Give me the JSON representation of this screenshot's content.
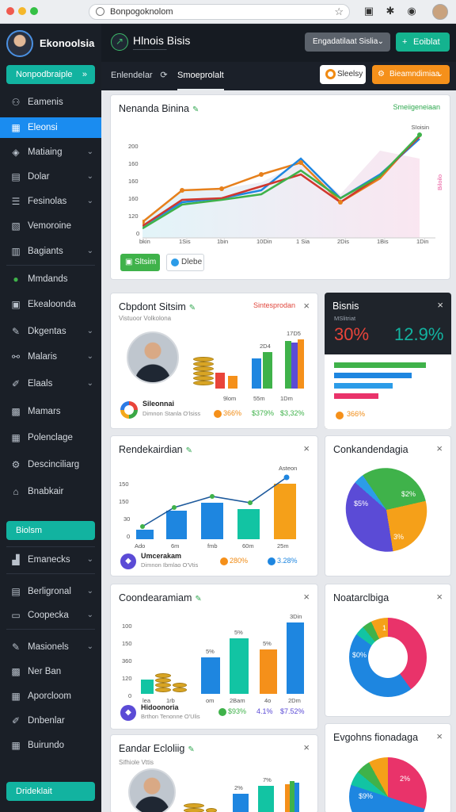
{
  "browser": {
    "url": "Bonpogoknolom",
    "colors": {
      "red": "#f05a4f",
      "yellow": "#f5b72b",
      "green": "#35c045"
    }
  },
  "sidebar": {
    "profile_name": "Ekonoolsia",
    "primary_button": "Nonpodbraiple",
    "primary_button_arrow": "»",
    "items": [
      {
        "label": "Eamenis",
        "icon": "users-icon"
      },
      {
        "label": "Eleonsi",
        "icon": "dashboard-icon"
      },
      {
        "label": "Matiaing",
        "icon": "layers-icon"
      },
      {
        "label": "Dolar",
        "icon": "grid-icon"
      },
      {
        "label": "Fesinolas",
        "icon": "list-icon"
      },
      {
        "label": "Vemoroine",
        "icon": "document-icon"
      },
      {
        "label": "Bagiants",
        "icon": "folder-icon"
      },
      {
        "label": "Mmdands",
        "icon": "chat-icon"
      },
      {
        "label": "Ekealoonda",
        "icon": "briefcase-icon"
      },
      {
        "label": "Dkgentas",
        "icon": "pin-icon"
      },
      {
        "label": "Malaris",
        "icon": "share-icon"
      },
      {
        "label": "Elaals",
        "icon": "edit-icon"
      },
      {
        "label": "Mamars",
        "icon": "building-icon"
      },
      {
        "label": "Polenclage",
        "icon": "calendar-icon"
      },
      {
        "label": "Descinciliarg",
        "icon": "settings-icon"
      },
      {
        "label": "Bnabkair",
        "icon": "bank-icon"
      }
    ],
    "secondary_button": "Biolsm",
    "items2": [
      {
        "label": "Emanecks",
        "icon": "chart-icon"
      },
      {
        "label": "Berligronal",
        "icon": "calendar-icon"
      },
      {
        "label": "Coopecka",
        "icon": "box-icon"
      },
      {
        "label": "Masionels",
        "icon": "pin-icon"
      },
      {
        "label": "Ner Ban",
        "icon": "building-icon"
      },
      {
        "label": "Aporcloom",
        "icon": "grid-icon"
      },
      {
        "label": "Dnbenlar",
        "icon": "edit-icon"
      },
      {
        "label": "Buirundo",
        "icon": "grid-icon"
      }
    ],
    "bottom_button": "Drideklait"
  },
  "topbar": {
    "title": "Hlnois Bisis",
    "subtitle": "──────────",
    "dropdown": "Engadatilaat Sislia",
    "action": "Eoiblat",
    "action_icon": "+"
  },
  "tabs": {
    "tab1": "Enlendelar",
    "tab2": "Smoeprolalt",
    "pill_white": "Sleelsy",
    "pill_orange": "Bieamndimiaa"
  },
  "cards": {
    "line": {
      "title": "Nenanda Binina",
      "badge": "Smeiigeneiaan",
      "corner_label": "SIoisin",
      "right_label": "Biloilo",
      "btn1": "Sltsim",
      "btn2": "Dlebe",
      "y_ticks": [
        "1D",
        "200",
        "160",
        "160",
        "160",
        "150",
        "120",
        "0"
      ],
      "x_ticks": [
        "bkin",
        "1Sis",
        "1bin",
        "10Din",
        "1 Sia",
        "2Dis",
        "1Bis",
        "1Din"
      ]
    },
    "bars1": {
      "title": "Cbpdont Sitsim",
      "subtitle": "Vistuoor Volkolona",
      "top_label": "Sintesprodan",
      "label_a": "17D5",
      "label_b": "2D4",
      "x_ticks": [
        "9lom",
        "55m",
        "1Dm"
      ],
      "logo_name": "Sileonnai",
      "logo_sub": "Dimnon Stanla O'lsiss",
      "stat1": "366%",
      "stat2": "$379%",
      "stat3": "$3,32%"
    },
    "dark": {
      "title": "Bisnis",
      "sub": "MSlitriat",
      "big1": "30%",
      "big2": "12.9%",
      "foot": "366%"
    },
    "combo": {
      "title": "Rendekairdian",
      "top_label": "Asteon",
      "y_ticks": [
        "150",
        "150",
        "30",
        "0"
      ],
      "x_ticks": [
        "Ado",
        "6m",
        "fmb",
        "60m",
        "25m"
      ],
      "logo_name": "Umcerakam",
      "logo_sub": "Dimnon Ibmlao O'Vtis",
      "stat1": "280%",
      "stat2": "3.28%"
    },
    "pie1": {
      "title": "Conkandendagia",
      "label1": "$5%",
      "label2": "$2%",
      "label3": "3%"
    },
    "bars2": {
      "title": "Coondearamiam",
      "y_ticks": [
        "100",
        "150",
        "360",
        "120",
        "0"
      ],
      "top_labels": [
        "3Din",
        "5%",
        "5%",
        "5%"
      ],
      "x_ticks": [
        "lea",
        "1rb",
        "om",
        "2Bam",
        "4o",
        "2Dm"
      ],
      "logo_name": "Hidoonoria",
      "logo_sub": "Brthon Tenonne O'Ulis",
      "stat1": "$93%",
      "stat2": "4.1%",
      "stat3": "$7.52%"
    },
    "donut": {
      "title": "Noatarclbiga",
      "label1": "$0%",
      "label2": "1"
    },
    "bottom_left": {
      "title": "Eandar Ecloliig",
      "sub": "Sifhiole Vttis",
      "top_label": "2%",
      "top_label2": "7%"
    },
    "bottom_right": {
      "title": "Evgohns fionadaga",
      "label1": "$9%",
      "label2": "2%"
    }
  }
}
